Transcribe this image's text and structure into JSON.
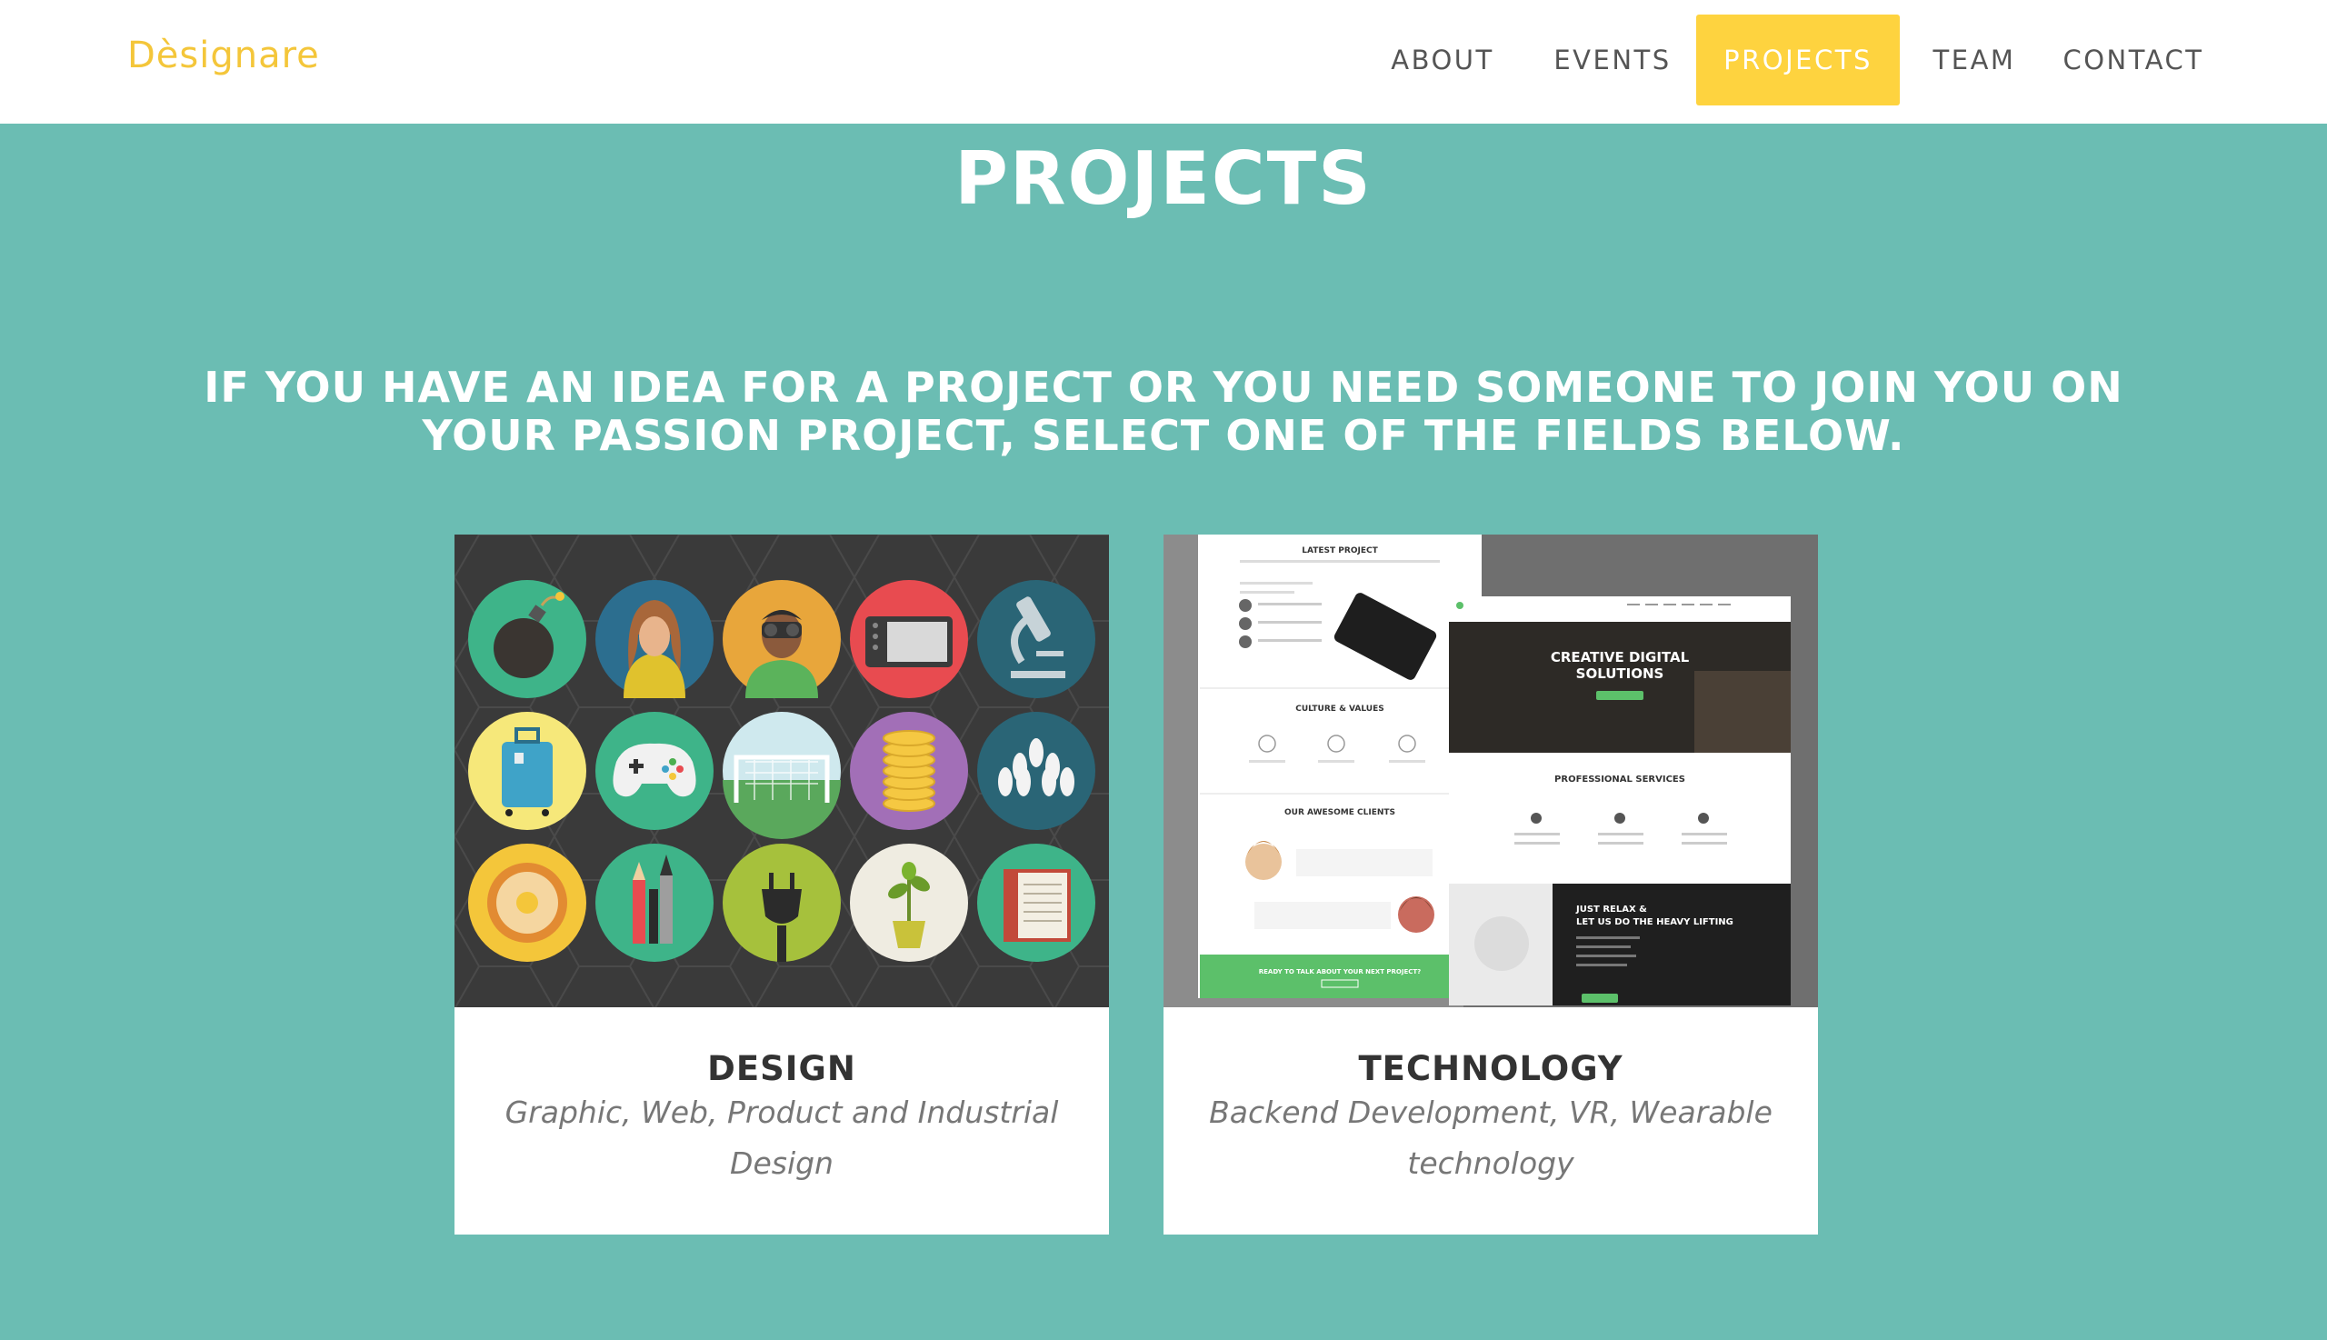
{
  "brand": {
    "name": "Dèsignare",
    "color": "#f4c63a"
  },
  "nav": {
    "items": [
      {
        "label": "ABOUT",
        "active": false
      },
      {
        "label": "EVENTS",
        "active": false
      },
      {
        "label": "PROJECTS",
        "active": true
      },
      {
        "label": "TEAM",
        "active": false
      },
      {
        "label": "CONTACT",
        "active": false
      }
    ],
    "active_color": "#fed33f"
  },
  "page": {
    "title": "PROJECTS",
    "intro": "IF YOU HAVE AN IDEA FOR A PROJECT OR YOU NEED SOMEONE TO JOIN YOU ON YOUR PASSION PROJECT, SELECT ONE OF THE FIELDS BELOW.",
    "background_color": "#6bbdb3"
  },
  "cards": [
    {
      "title": "DESIGN",
      "description": "Graphic, Web, Product and Industrial Design",
      "image_icons": [
        "bomb-icon",
        "woman-icon",
        "binoculars-icon",
        "drawing-tablet-icon",
        "microscope-icon",
        "suitcase-icon",
        "gamepad-icon",
        "soccer-goal-icon",
        "coin-stack-icon",
        "bowling-icon",
        "donut-icon",
        "pencils-icon",
        "plug-icon",
        "plant-icon",
        "book-icon"
      ]
    },
    {
      "title": "TECHNOLOGY",
      "description": "Backend Development, VR, Wearable technology",
      "mockup": {
        "latest_project": "LATEST PROJECT",
        "culture_values": "CULTURE & VALUES",
        "awesome_clients": "OUR AWESOME CLIENTS",
        "cta_banner": "READY TO TALK ABOUT YOUR NEXT PROJECT?",
        "hero_line1": "CREATIVE DIGITAL",
        "hero_line2": "SOLUTIONS",
        "professional_services": "PROFESSIONAL SERVICES",
        "relax_line1": "JUST RELAX &",
        "relax_line2": "LET US DO THE HEAVY LIFTING"
      }
    }
  ]
}
